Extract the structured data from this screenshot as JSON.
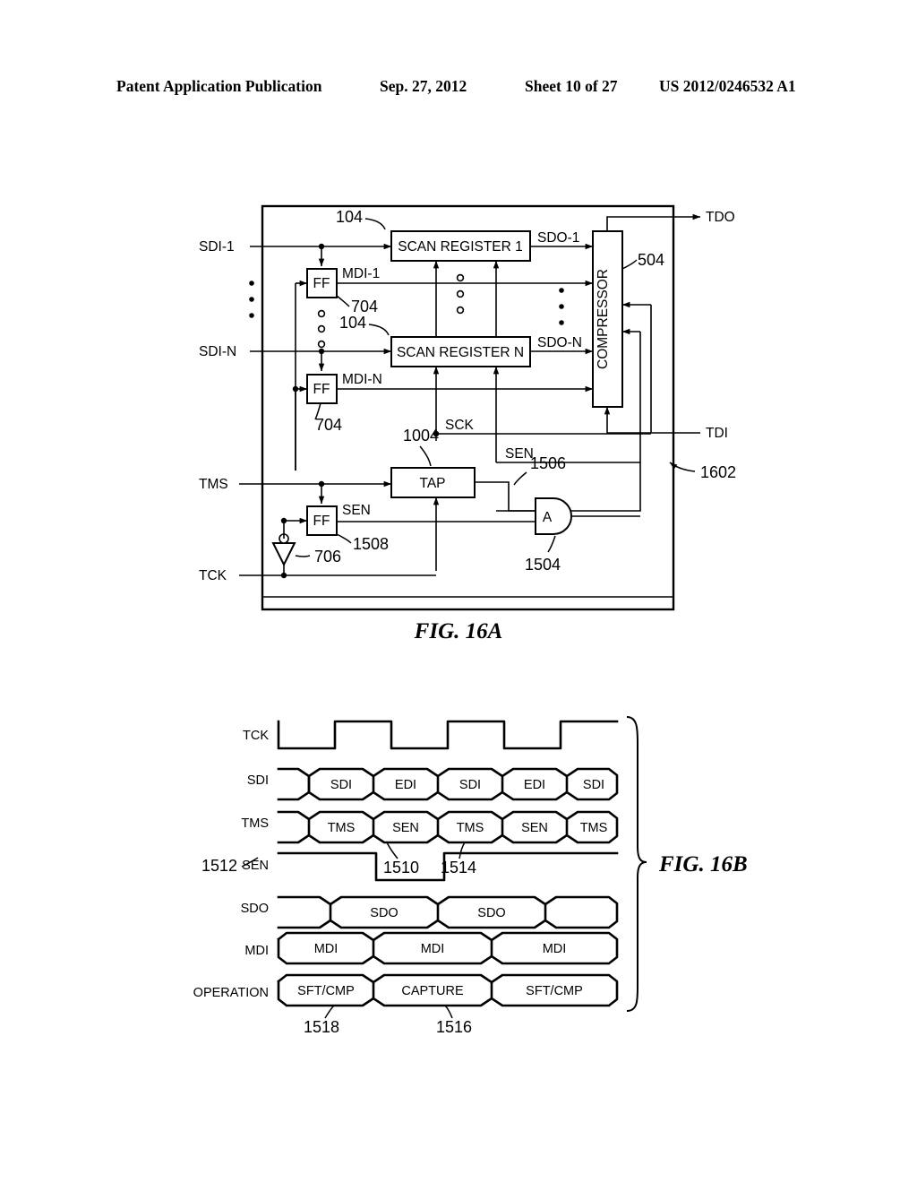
{
  "header": {
    "publication": "Patent Application Publication",
    "date": "Sep. 27, 2012",
    "sheet": "Sheet 10 of 27",
    "patent_number": "US 2012/0246532 A1"
  },
  "fig16a": {
    "caption": "FIG. 16A",
    "inputs": {
      "sdi_1": "SDI-1",
      "sdi_n": "SDI-N",
      "tms": "TMS",
      "tck": "TCK"
    },
    "outputs": {
      "tdo": "TDO",
      "tdi": "TDI"
    },
    "blocks": {
      "scan_register_1": "SCAN REGISTER 1",
      "scan_register_n": "SCAN REGISTER N",
      "compressor": "COMPRESSOR",
      "tap": "TAP",
      "ff_1": "FF",
      "ff_n": "FF",
      "ff_sen": "FF",
      "and_gate": "A"
    },
    "nets": {
      "mdi_1": "MDI-1",
      "mdi_n": "MDI-N",
      "sdo_1": "SDO-1",
      "sdo_n": "SDO-N",
      "sck": "SCK",
      "sen_bus": "SEN",
      "sen_ff": "SEN"
    },
    "refs": {
      "scan_reg_1": "104",
      "scan_reg_n": "104",
      "ff_1": "704",
      "ff_n": "704",
      "compressor": "504",
      "tap": "1004",
      "and_out": "1506",
      "and_gate": "1504",
      "ff_sen": "1508",
      "inverter": "706",
      "boundary": "1602"
    }
  },
  "fig16b": {
    "caption": "FIG. 16B",
    "row_labels": [
      "TCK",
      "SDI",
      "TMS",
      "SEN",
      "SDO",
      "MDI",
      "OPERATION"
    ],
    "sdi_cells": [
      "SDI",
      "EDI",
      "SDI",
      "EDI",
      "SDI"
    ],
    "tms_cells": [
      "TMS",
      "SEN",
      "TMS",
      "SEN",
      "TMS"
    ],
    "sdo_cells": [
      "SDO",
      "SDO"
    ],
    "mdi_cells": [
      "MDI",
      "MDI",
      "MDI"
    ],
    "operation_cells": [
      "SFT/CMP",
      "CAPTURE",
      "SFT/CMP"
    ],
    "refs": {
      "sen_row": "1512",
      "sen_fall": "1510",
      "sen_rise": "1514",
      "operation_1": "1518",
      "operation_2": "1516"
    }
  }
}
